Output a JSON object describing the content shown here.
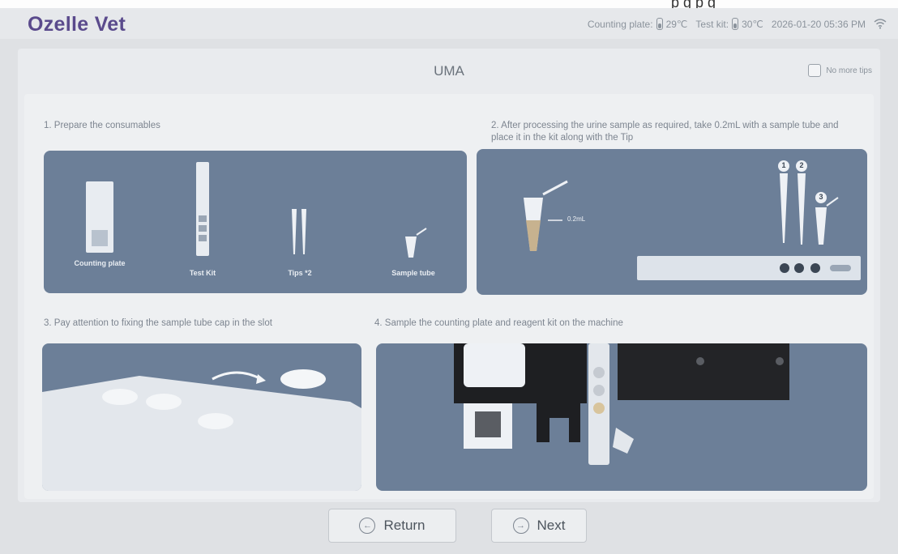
{
  "overlay": {
    "text": "p        g  p  g"
  },
  "header": {
    "brand": "Ozelle Vet",
    "counting_plate_label": "Counting plate:",
    "counting_plate_temp": "29℃",
    "test_kit_label": "Test kit:",
    "test_kit_temp": "30℃",
    "datetime": "2026-01-20  05:36 PM",
    "wifi_icon": "wifi-icon"
  },
  "dialog": {
    "title": "UMA",
    "no_more_tips": "No more tips"
  },
  "steps": [
    {
      "text": "1. Prepare the consumables"
    },
    {
      "text": "2. After processing the urine sample as required, take 0.2mL with a sample tube and place it in the kit along with the Tip"
    },
    {
      "text": "3. Pay attention to fixing the sample tube cap in the slot"
    },
    {
      "text": "4. Sample the counting plate and reagent kit on the machine"
    }
  ],
  "panel1": {
    "items": [
      "Counting plate",
      "Test Kit",
      "Tips *2",
      "Sample tube"
    ]
  },
  "panel2": {
    "volume": "0.2mL",
    "markers": [
      "1",
      "2",
      "3"
    ]
  },
  "buttons": {
    "return": "Return",
    "next": "Next"
  },
  "colors": {
    "brand": "#5a4a8c",
    "panel": "#6c7f98",
    "background": "#dfe1e4"
  }
}
